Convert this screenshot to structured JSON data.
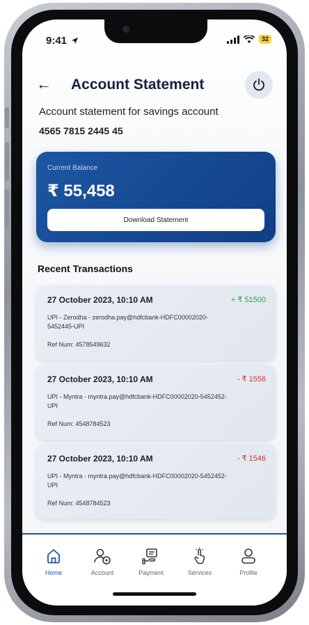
{
  "status": {
    "time": "9:41",
    "battery": "32"
  },
  "header": {
    "title": "Account Statement"
  },
  "account": {
    "description": "Account statement for savings account",
    "number": "4565 7815 2445 45"
  },
  "balance_card": {
    "label": "Current Balance",
    "amount": "₹ 55,458",
    "download_label": "Download Statement"
  },
  "transactions_title": "Recent Transactions",
  "transactions": [
    {
      "date": "27 October 2023, 10:10 AM",
      "amount": "+ ₹ 51500",
      "type": "credit",
      "description": "UPI - Zerodha - zerodha.pay@hdfcbank-HDFC00002020-5452445-UPI",
      "ref": "Ref Num: 4578549632"
    },
    {
      "date": "27 October 2023, 10:10 AM",
      "amount": "- ₹ 1556",
      "type": "debit",
      "description": "UPI - Myntra - myntra.pay@hdfcbank-HDFC00002020-5452452-UPI",
      "ref": "Ref Num: 4548784523"
    },
    {
      "date": "27 October 2023, 10:10 AM",
      "amount": "- ₹ 1546",
      "type": "debit",
      "description": "UPI - Myntra - myntra.pay@hdfcbank-HDFC00002020-5452452-UPI",
      "ref": "Ref Num: 4548784523"
    }
  ],
  "nav": {
    "items": [
      {
        "label": "Home",
        "icon": "home-icon",
        "active": true
      },
      {
        "label": "Account",
        "icon": "account-icon"
      },
      {
        "label": "Payment",
        "icon": "payment-icon"
      },
      {
        "label": "Services",
        "icon": "services-icon"
      },
      {
        "label": "Profile",
        "icon": "profile-icon"
      }
    ]
  },
  "colors": {
    "brand": "#1d56a2",
    "credit": "#23a34a",
    "debit": "#d92c2c"
  }
}
